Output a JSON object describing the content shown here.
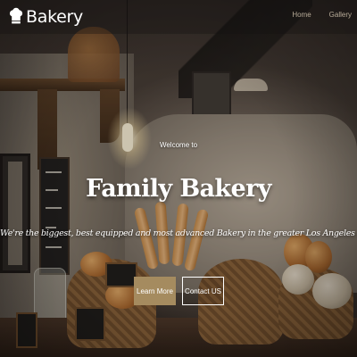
{
  "navbar": {
    "brand": "Bakery",
    "links": [
      {
        "label": "Home"
      },
      {
        "label": "Gallery"
      }
    ]
  },
  "hero": {
    "welcome": "Welcome to",
    "title": "Family Bakery",
    "tagline": "We're the biggest, best equipped and most advanced Bakery in the greater Los Angeles area.",
    "primary_button": "Learn More",
    "secondary_button": "Contact US"
  },
  "colors": {
    "accent": "#a58b5f",
    "nav_link": "#b7ab98",
    "text": "#ffffff"
  },
  "icons": {
    "brand_icon": "chef-hat-icon"
  }
}
